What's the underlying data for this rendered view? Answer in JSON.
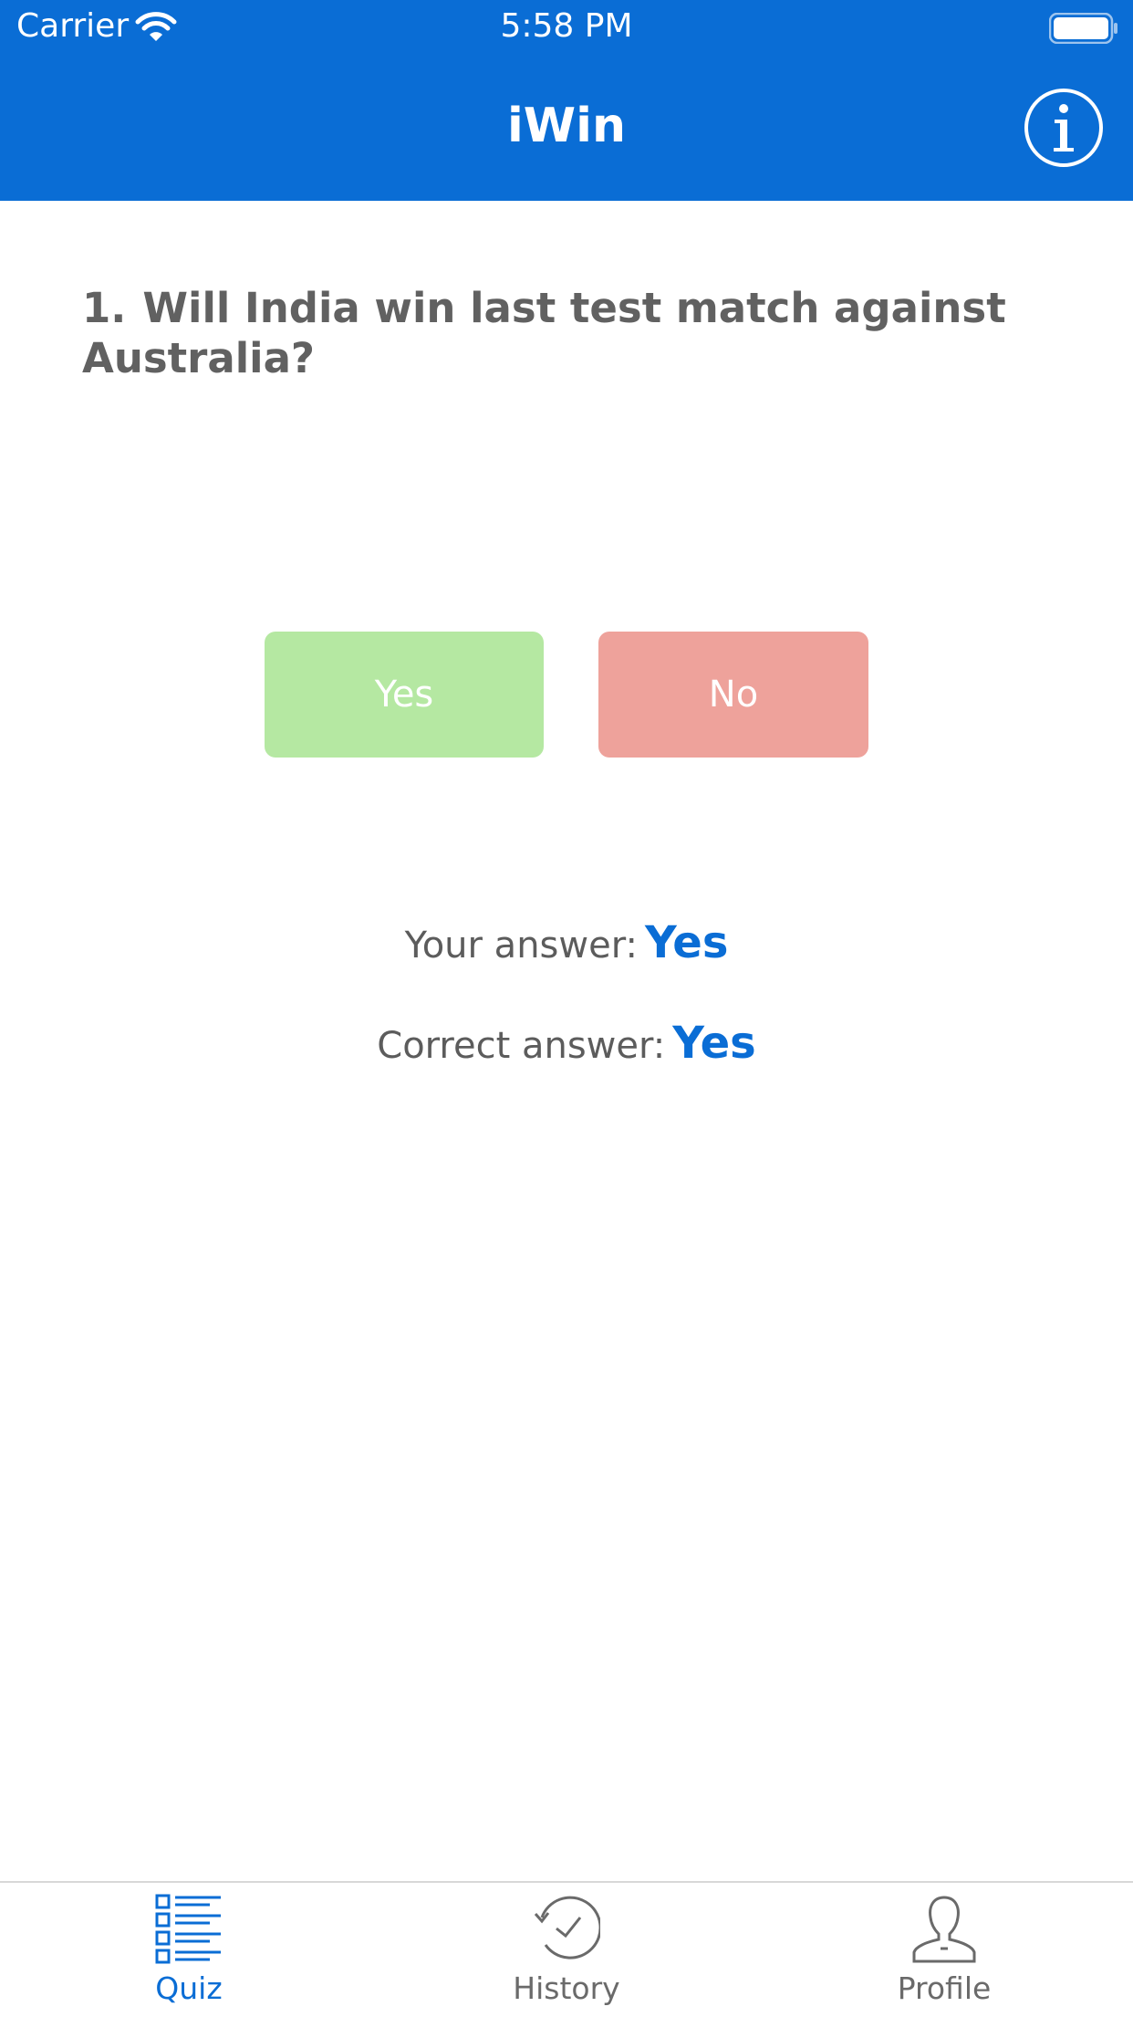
{
  "status_bar": {
    "carrier": "Carrier",
    "time": "5:58 PM"
  },
  "header": {
    "title": "iWin",
    "info_icon": "info-circle-icon"
  },
  "question": {
    "number": "1.",
    "text": "Will India win last test match against Australia?"
  },
  "options": {
    "yes_label": "Yes",
    "no_label": "No"
  },
  "answers": {
    "your_label": "Your answer:",
    "your_value": "Yes",
    "correct_label": "Correct answer:",
    "correct_value": "Yes"
  },
  "tabs": [
    {
      "label": "Quiz",
      "icon": "quiz-list-icon",
      "active": true
    },
    {
      "label": "History",
      "icon": "history-clock-icon",
      "active": false
    },
    {
      "label": "Profile",
      "icon": "profile-person-icon",
      "active": false
    }
  ],
  "colors": {
    "primary": "#0a6dd5",
    "yes": "#b5e8a2",
    "no": "#eea29b"
  }
}
